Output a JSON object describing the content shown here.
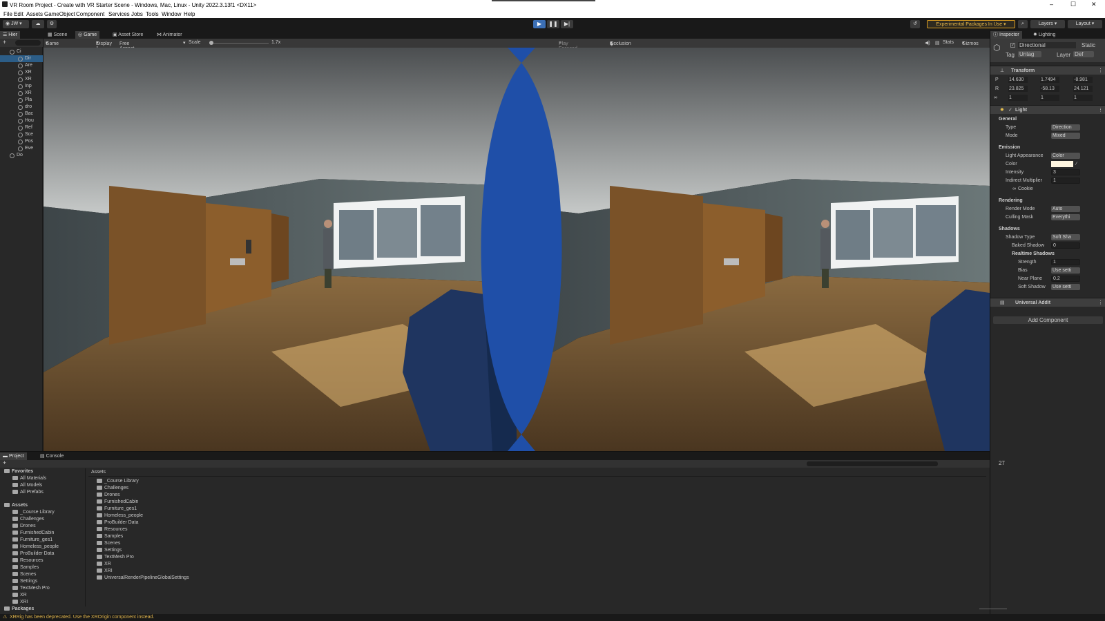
{
  "window": {
    "title": "VR Room Project - Create with VR Starter Scene - Windows, Mac, Linux - Unity 2022.3.13f1 <DX11>",
    "min": "–",
    "max": "☐",
    "close": "✕"
  },
  "menu": [
    "File",
    "Edit",
    "Assets",
    "GameObject",
    "Component",
    "Services",
    "Jobs",
    "Tools",
    "Window",
    "Help"
  ],
  "toolbar": {
    "account": "JW",
    "experimental": "Experimental Packages In Use",
    "layers": "Layers",
    "layout": "Layout"
  },
  "tabs": {
    "hierarchy": "Hier",
    "scene": "Scene",
    "game": "Game",
    "asset_store": "Asset Store",
    "animator": "Animator",
    "inspector": "Inspector",
    "lighting": "Lighting",
    "project": "Project",
    "console": "Console"
  },
  "hierarchy": [
    {
      "label": "Ci",
      "depth": 0
    },
    {
      "label": "Dir",
      "depth": 1
    },
    {
      "label": "Are",
      "depth": 1
    },
    {
      "label": "XR",
      "depth": 1
    },
    {
      "label": "XR",
      "depth": 1
    },
    {
      "label": "Inp",
      "depth": 1
    },
    {
      "label": "XR",
      "depth": 1
    },
    {
      "label": "Pla",
      "depth": 1
    },
    {
      "label": "dro",
      "depth": 1
    },
    {
      "label": "Bac",
      "depth": 1
    },
    {
      "label": "Hou",
      "depth": 1
    },
    {
      "label": "Ref",
      "depth": 1
    },
    {
      "label": "Sce",
      "depth": 1
    },
    {
      "label": "Pos",
      "depth": 1
    },
    {
      "label": "Eve",
      "depth": 1
    },
    {
      "label": "Do",
      "depth": 0
    }
  ],
  "game_view": {
    "mode": "Game",
    "display": "Display 1",
    "aspect": "Free Aspect",
    "scale_label": "Scale",
    "scale_value": "1.7x",
    "play_focused": "Play Focused",
    "occlusion": "Occlusion",
    "stats": "Stats",
    "gizmos": "Gizmos"
  },
  "inspector": {
    "object_name": "Directional",
    "static": "Static",
    "tag_label": "Tag",
    "tag_value": "Untag",
    "layer_label": "Layer",
    "layer_value": "Def",
    "transform": {
      "title": "Transform",
      "p": {
        "label": "P",
        "x": "14.630",
        "y": "1.7494",
        "z": "-8.981"
      },
      "r": {
        "label": "R",
        "x": "23.825",
        "y": "-58.13",
        "z": "24.121"
      },
      "s": {
        "x": "1",
        "y": "1",
        "z": "1"
      }
    },
    "light": {
      "title": "Light",
      "general": "General",
      "type_label": "Type",
      "type_value": "Direction",
      "mode_label": "Mode",
      "mode_value": "Mixed",
      "emission": "Emission",
      "appearance_label": "Light Appearance",
      "appearance_value": "Color",
      "color_label": "Color",
      "intensity_label": "Intensity",
      "intensity_value": "3",
      "indirect_label": "Indirect Multiplier",
      "indirect_value": "1",
      "cookie_label": "Cookie",
      "rendering": "Rendering",
      "render_mode_label": "Render Mode",
      "render_mode_value": "Auto",
      "culling_label": "Culling Mask",
      "culling_value": "Everythi",
      "shadows": "Shadows",
      "shadow_type_label": "Shadow Type",
      "shadow_type_value": "Soft Sha",
      "baked_label": "Baked Shadow",
      "baked_value": "0",
      "realtime": "Realtime Shadows",
      "strength_label": "Strength",
      "strength_value": "1",
      "bias_label": "Bias",
      "bias_value": "Use setti",
      "near_label": "Near Plane",
      "near_value": "0.2",
      "soft_label": "Soft Shadow",
      "soft_value": "Use setti"
    },
    "universal": "Universal Addit",
    "add_component": "Add Component"
  },
  "project": {
    "favorites": "Favorites",
    "fav_items": [
      "All Materials",
      "All Models",
      "All Prefabs"
    ],
    "assets_root": "Assets",
    "tree": [
      "_Course Library",
      "Challenges",
      "Drones",
      "FurnishedCabin",
      "Furniture_ges1",
      "Homeless_people",
      "ProBuilder Data",
      "Resources",
      "Samples",
      "Scenes",
      "Settings",
      "TextMesh Pro",
      "XR",
      "XRI"
    ],
    "packages": "Packages",
    "breadcrumb": "Assets",
    "files": [
      "_Course Library",
      "Challenges",
      "Drones",
      "FurnishedCabin",
      "Furniture_ges1",
      "Homeless_people",
      "ProBuilder Data",
      "Resources",
      "Samples",
      "Scenes",
      "Settings",
      "TextMesh Pro",
      "XR",
      "XRI",
      "UniversalRenderPipelineGlobalSettings"
    ],
    "count": "27"
  },
  "status": {
    "message": "XRRig has been deprecated. Use the XROrigin component instead."
  },
  "colors": {
    "accent_blue": "#1f4fa8",
    "play_active": "#3b6fb5",
    "warning": "#e0b44b"
  }
}
